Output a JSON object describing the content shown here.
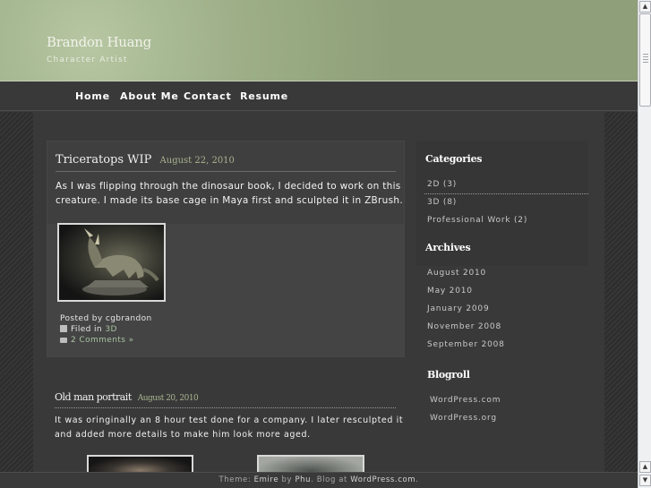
{
  "header": {
    "title": "Brandon Huang",
    "subtitle": "Character Artist"
  },
  "nav": {
    "items": [
      "Home",
      "About Me",
      "Contact",
      "Resume"
    ]
  },
  "posts": [
    {
      "title": "Triceratops WIP",
      "date": "August 22, 2010",
      "text_line1": "As I was flipping through the dinosaur book, I decided to work on this",
      "text_line2": "creature. I made its base cage in Maya first and sculpted it in ZBrush.",
      "posted_by": "Posted by cgbrandon",
      "filed_in_label": "Filed in",
      "filed_in_category": "3D",
      "comments": "2 Comments »"
    },
    {
      "title": "Old man portrait",
      "date": "August 20, 2010",
      "text_line1": "It was oringinally an 8 hour test done for a company. I later resculpted it",
      "text_line2": "and added more details to make him look more aged."
    }
  ],
  "sidebar": {
    "categories_heading": "Categories",
    "categories": [
      "2D (3)",
      "3D (8)",
      "Professional Work (2)"
    ],
    "archives_heading": "Archives",
    "archives": [
      "August 2010",
      "May 2010",
      "January 2009",
      "November 2008",
      "September 2008"
    ],
    "blogroll_heading": "Blogroll",
    "blogroll": [
      "WordPress.com",
      "WordPress.org"
    ]
  },
  "footer": {
    "prefix": "Theme:",
    "theme_name": "Emire",
    "by": "by",
    "author": "Phu",
    "suffix": ". Blog at",
    "host": "WordPress.com",
    "end": "."
  },
  "colors": {
    "header_green": "#9fb089",
    "date_green": "#a8b38e",
    "background": "#393939"
  }
}
